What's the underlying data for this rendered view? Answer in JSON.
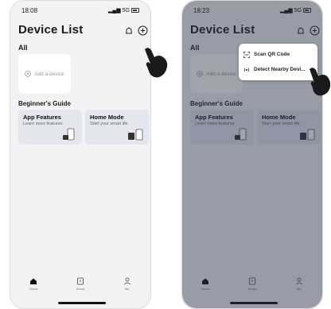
{
  "left_screen": {
    "status": {
      "time": "18:08",
      "signal": "5G"
    },
    "title": "Device List",
    "filter": "All",
    "add_device": "Add a device",
    "guide_title": "Beginner's Guide",
    "cards": [
      {
        "title": "App Features",
        "subtitle": "Learn more features"
      },
      {
        "title": "Home Mode",
        "subtitle": "Start your smart life"
      }
    ],
    "tabs": [
      {
        "label": "Home",
        "icon": "home-icon"
      },
      {
        "label": "Smart",
        "icon": "smart-icon"
      },
      {
        "label": "Me",
        "icon": "person-icon"
      }
    ]
  },
  "right_screen": {
    "status": {
      "time": "18:23",
      "signal": "5G"
    },
    "title": "Device List",
    "filter": "All",
    "add_device": "Add a device",
    "guide_title": "Beginner's Guide",
    "cards": [
      {
        "title": "App Features",
        "subtitle": "Learn more features"
      },
      {
        "title": "Home Mode",
        "subtitle": "Start your smart life"
      }
    ],
    "menu": [
      {
        "label": "Scan QR Code",
        "icon": "scan-qr-icon"
      },
      {
        "label": "Detect Nearby Devi...",
        "icon": "detect-nearby-icon"
      }
    ],
    "tabs": [
      {
        "label": "Home",
        "icon": "home-icon"
      },
      {
        "label": "Smart",
        "icon": "smart-icon"
      },
      {
        "label": "Me",
        "icon": "person-icon"
      }
    ]
  },
  "colors": {
    "screen_bg": "#f2f2f4",
    "card_bg": "#e3e6ee",
    "overlay": "#283246"
  }
}
